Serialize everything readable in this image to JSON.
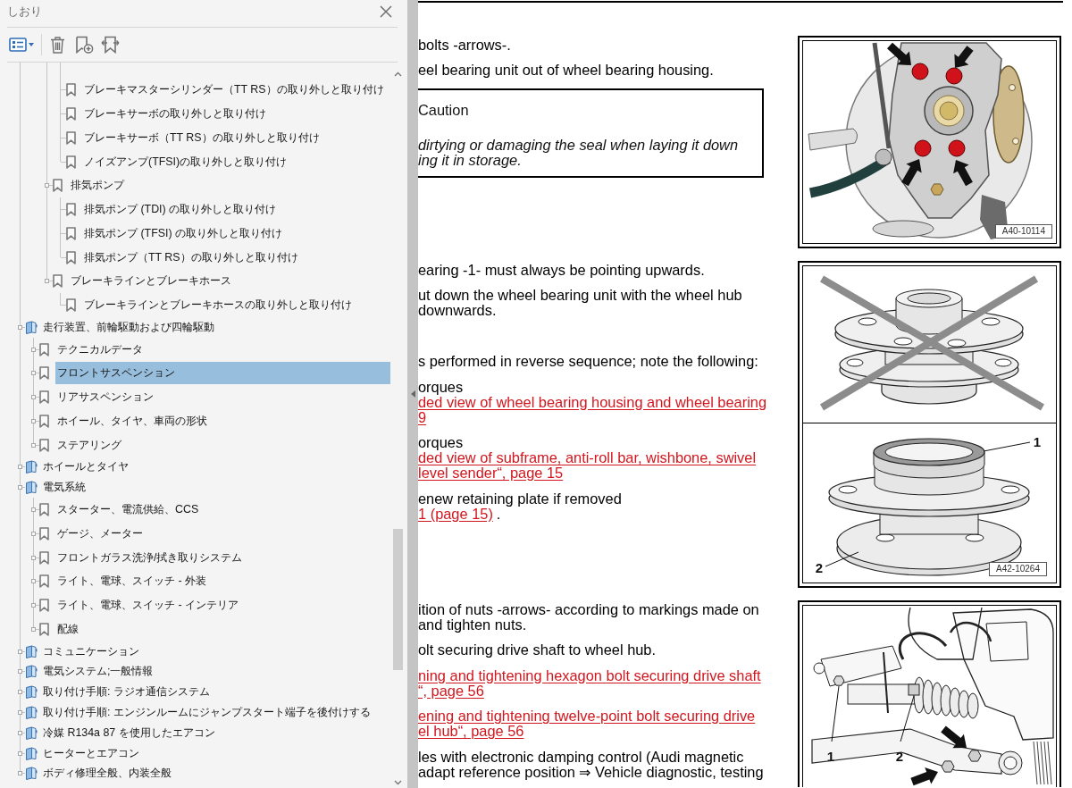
{
  "bookmarks_panel": {
    "title": "しおり",
    "items": [
      {
        "children": [
          {
            "children": [
              {
                "children": [
                  {
                    "label": "ブレーキマスターシリンダー（TT RS）の取り外しと取り付け",
                    "kind": "bookmark",
                    "expandable": false,
                    "selected": false
                  },
                  {
                    "label": "ブレーキサーボの取り外しと取り付け",
                    "kind": "bookmark",
                    "expandable": false,
                    "selected": false
                  },
                  {
                    "label": "ブレーキサーボ（TT RS）の取り外しと取り付け",
                    "kind": "bookmark",
                    "expandable": false,
                    "selected": false
                  },
                  {
                    "label": "ノイズアンプ(TFSI)の取り外しと取り付け",
                    "kind": "bookmark",
                    "expandable": false,
                    "selected": false
                  }
                ]
              },
              {
                "label": "排気ポンプ",
                "kind": "bookmark",
                "expandable": true,
                "selected": false,
                "children": [
                  {
                    "label": "排気ポンプ (TDI) の取り外しと取り付け",
                    "kind": "bookmark",
                    "expandable": false,
                    "selected": false
                  },
                  {
                    "label": "排気ポンプ (TFSI) の取り外しと取り付け",
                    "kind": "bookmark",
                    "expandable": false,
                    "selected": false
                  },
                  {
                    "label": "排気ポンプ（TT RS）の取り外しと取り付け",
                    "kind": "bookmark",
                    "expandable": false,
                    "selected": false
                  }
                ]
              },
              {
                "label": "ブレーキラインとブレーキホース",
                "kind": "bookmark",
                "expandable": true,
                "selected": false,
                "children": [
                  {
                    "label": "ブレーキラインとブレーキホースの取り外しと取り付け",
                    "kind": "bookmark",
                    "expandable": false,
                    "selected": false
                  }
                ]
              }
            ]
          }
        ]
      },
      {
        "label": "走行装置、前輪駆動および四輪駆動",
        "kind": "book",
        "expandable": true,
        "selected": false,
        "children": [
          {
            "label": "テクニカルデータ",
            "kind": "bookmark",
            "expandable": true,
            "selected": false
          },
          {
            "label": "フロントサスペンション",
            "kind": "bookmark",
            "expandable": true,
            "selected": true
          },
          {
            "label": "リアサスペンション",
            "kind": "bookmark",
            "expandable": true,
            "selected": false
          },
          {
            "label": "ホイール、タイヤ、車両の形状",
            "kind": "bookmark",
            "expandable": true,
            "selected": false
          },
          {
            "label": "ステアリング",
            "kind": "bookmark",
            "expandable": true,
            "selected": false
          }
        ]
      },
      {
        "label": "ホイールとタイヤ",
        "kind": "book",
        "expandable": true,
        "selected": false
      },
      {
        "label": "電気系統",
        "kind": "book",
        "expandable": true,
        "selected": false,
        "children": [
          {
            "label": "スターター、電流供給、CCS",
            "kind": "bookmark",
            "expandable": true,
            "selected": false
          },
          {
            "label": "ゲージ、メーター",
            "kind": "bookmark",
            "expandable": true,
            "selected": false
          },
          {
            "label": "フロントガラス洗浄/拭き取りシステム",
            "kind": "bookmark",
            "expandable": true,
            "selected": false
          },
          {
            "label": "ライト、電球、スイッチ - 外装",
            "kind": "bookmark",
            "expandable": true,
            "selected": false
          },
          {
            "label": "ライト、電球、スイッチ - インテリア",
            "kind": "bookmark",
            "expandable": true,
            "selected": false
          },
          {
            "label": "配線",
            "kind": "bookmark",
            "expandable": true,
            "selected": false
          }
        ]
      },
      {
        "label": "コミュニケーション",
        "kind": "book",
        "expandable": true,
        "selected": false
      },
      {
        "label": "電気システム;一般情報",
        "kind": "book",
        "expandable": true,
        "selected": false
      },
      {
        "label": "取り付け手順: ラジオ通信システム",
        "kind": "book",
        "expandable": true,
        "selected": false
      },
      {
        "label": "取り付け手順: エンジンルームにジャンプスタート端子を後付けする",
        "kind": "book",
        "expandable": true,
        "selected": false
      },
      {
        "label": "冷媒 R134a 87 を使用したエアコン",
        "kind": "book",
        "expandable": true,
        "selected": false
      },
      {
        "label": "ヒーターとエアコン",
        "kind": "book",
        "expandable": true,
        "selected": false
      },
      {
        "label": "ボディ修理全般、内装全般",
        "kind": "book",
        "expandable": true,
        "selected": false
      }
    ]
  },
  "document": {
    "sections": [
      {
        "paragraphs": [
          {
            "kind": "text",
            "lines": [
              [
                {
                  "text": "bolts -arrows-.",
                  "link": false
                }
              ]
            ]
          },
          {
            "kind": "text",
            "lines": [
              [
                {
                  "text": "eel bearing unit out of wheel bearing housing.",
                  "link": false
                }
              ]
            ]
          },
          {
            "kind": "caution",
            "title": "Caution",
            "lines": [
              "dirtying or damaging the seal when laying it down",
              "ing it in storage."
            ]
          }
        ],
        "figure": {
          "panels": [
            {
              "kind": "knuckle",
              "crossed": false,
              "label": "A40-10114"
            }
          ]
        }
      },
      {
        "paragraphs": [
          {
            "kind": "text",
            "lines": [
              [
                {
                  "text": "earing -1- must always be pointing upwards.",
                  "link": false
                }
              ]
            ]
          },
          {
            "kind": "text",
            "lines": [
              [
                {
                  "text": "ut down the wheel bearing unit with the wheel hub",
                  "link": false
                }
              ],
              [
                {
                  "text": "downwards.",
                  "link": false
                }
              ]
            ]
          },
          {
            "kind": "text",
            "lines": [
              [
                {
                  "text": "s performed in reverse sequence; note the following:",
                  "link": false
                }
              ]
            ]
          },
          {
            "kind": "text",
            "lines": [
              [
                {
                  "text": "orques",
                  "link": false
                }
              ],
              [
                {
                  "text": "ded view of wheel bearing housing and wheel bearing",
                  "link": true
                }
              ],
              [
                {
                  "text": "9",
                  "link": true
                }
              ]
            ]
          },
          {
            "kind": "text",
            "lines": [
              [
                {
                  "text": "orques",
                  "link": false
                }
              ],
              [
                {
                  "text": "ded view of subframe, anti-roll bar, wishbone, swivel",
                  "link": true
                }
              ],
              [
                {
                  "text": "level sender“, page 15",
                  "link": true
                }
              ]
            ]
          },
          {
            "kind": "text",
            "lines": [
              [
                {
                  "text": "enew retaining plate if removed",
                  "link": false
                }
              ],
              [
                {
                  "text": "1 (page 15)",
                  "link": true
                },
                {
                  "text": ".",
                  "link": false
                }
              ]
            ]
          }
        ],
        "figure": {
          "panels": [
            {
              "kind": "hub",
              "crossed": true
            },
            {
              "kind": "bearing",
              "crossed": false,
              "callouts": [
                "1",
                "2"
              ],
              "label": "A42-10264"
            }
          ]
        }
      },
      {
        "paragraphs": [
          {
            "kind": "text",
            "lines": [
              [
                {
                  "text": "ition of nuts -arrows- according to markings made on",
                  "link": false
                }
              ],
              [
                {
                  "text": "and tighten nuts.",
                  "link": false
                }
              ]
            ]
          },
          {
            "kind": "text",
            "lines": [
              [
                {
                  "text": "olt securing drive shaft to wheel hub.",
                  "link": false
                }
              ]
            ]
          },
          {
            "kind": "text",
            "lines": [
              [
                {
                  "text": "ning and tightening hexagon bolt securing drive shaft",
                  "link": true
                }
              ],
              [
                {
                  "text": "“, page 56",
                  "link": true
                }
              ]
            ]
          },
          {
            "kind": "text",
            "lines": [
              [
                {
                  "text": "ening and tightening twelve-point bolt securing drive",
                  "link": true
                }
              ],
              [
                {
                  "text": "el hub“, page 56",
                  "link": true
                }
              ]
            ]
          },
          {
            "kind": "text",
            "lines": [
              [
                {
                  "text": "les with electronic damping control (Audi magnetic",
                  "link": false
                }
              ],
              [
                {
                  "text": "adapt reference position ⇒ Vehicle diagnostic, testing",
                  "link": false
                }
              ]
            ]
          }
        ],
        "figure": {
          "panels": [
            {
              "kind": "driveshaft",
              "crossed": false,
              "callouts": [
                "1",
                "2"
              ]
            }
          ]
        }
      }
    ]
  }
}
